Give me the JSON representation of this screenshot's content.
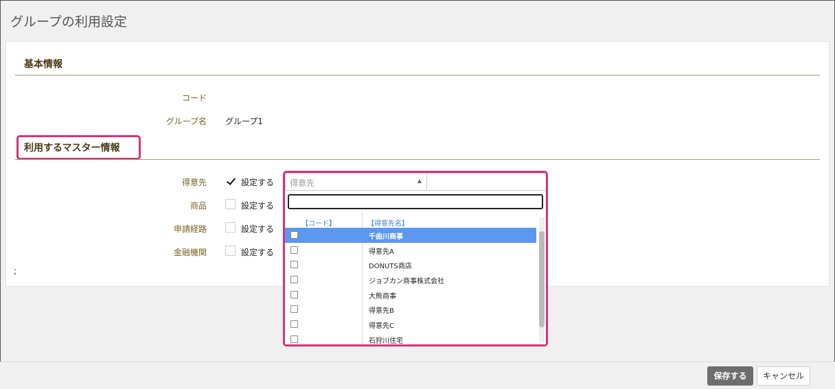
{
  "page": {
    "title": "グループの利用設定"
  },
  "basic_info": {
    "heading": "基本情報",
    "code_label": "コード",
    "code_value": "",
    "group_name_label": "グループ名",
    "group_name_value": "グループ1"
  },
  "master_info": {
    "heading": "利用するマスター情報",
    "rows": [
      {
        "label": "得意先",
        "checkbox_label": "設定する",
        "checked": true
      },
      {
        "label": "商品",
        "checkbox_label": "設定する",
        "checked": false
      },
      {
        "label": "申請経路",
        "checkbox_label": "設定する",
        "checked": false
      },
      {
        "label": "金融機関",
        "checkbox_label": "設定する",
        "checked": false
      }
    ]
  },
  "dropdown": {
    "selected_text": "得意先",
    "search_value": "",
    "column_code": "【コード】",
    "column_name": "【得意先名】",
    "items": [
      {
        "code": "",
        "name": "千曲川商事",
        "highlighted": true
      },
      {
        "code": "",
        "name": "得意先A",
        "highlighted": false
      },
      {
        "code": "",
        "name": "DONUTS商店",
        "highlighted": false
      },
      {
        "code": "",
        "name": "ジョブカン商事株式会社",
        "highlighted": false
      },
      {
        "code": "",
        "name": "大熊商事",
        "highlighted": false
      },
      {
        "code": "",
        "name": "得意先B",
        "highlighted": false
      },
      {
        "code": "",
        "name": "得意先C",
        "highlighted": false
      },
      {
        "code": "",
        "name": "石狩川住宅",
        "highlighted": false
      }
    ]
  },
  "stray_text": ";",
  "footer": {
    "save_label": "保存する",
    "cancel_label": "キャンセル"
  },
  "colors": {
    "highlight": "#d8317a",
    "label": "#7a6020",
    "selected_row": "#5c98f0",
    "save_button": "#6d6d6d"
  }
}
